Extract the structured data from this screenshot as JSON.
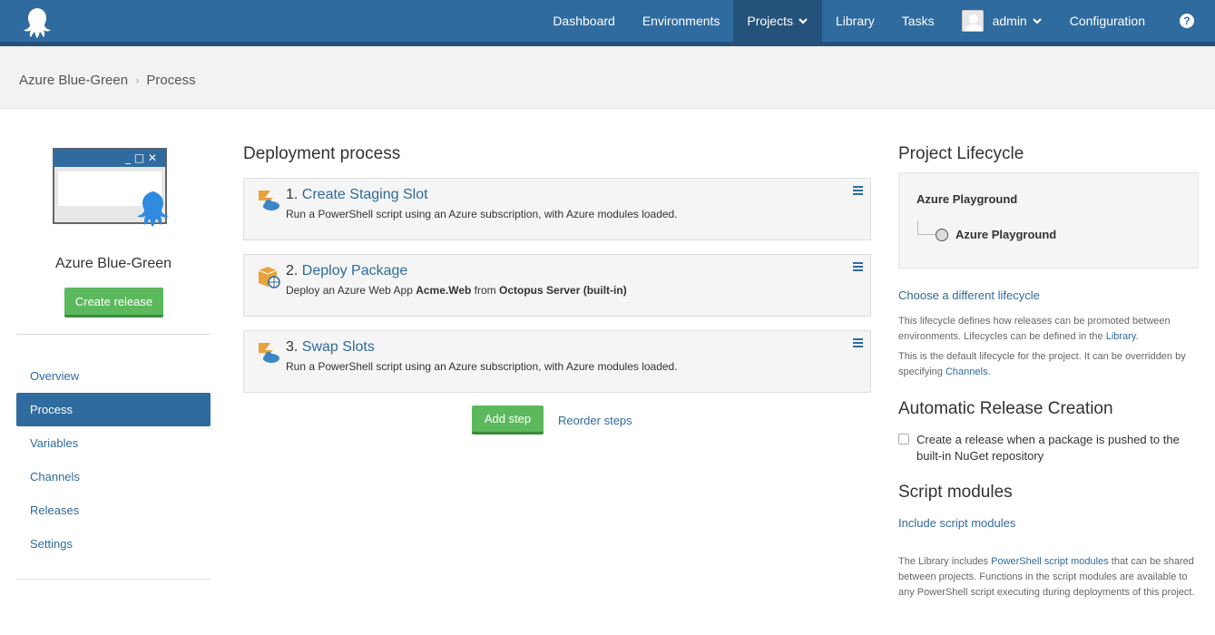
{
  "nav": {
    "items": [
      {
        "label": "Dashboard",
        "active": false
      },
      {
        "label": "Environments",
        "active": false
      },
      {
        "label": "Projects",
        "active": true,
        "dropdown": true
      },
      {
        "label": "Library",
        "active": false
      },
      {
        "label": "Tasks",
        "active": false
      }
    ],
    "user": "admin",
    "configuration": "Configuration",
    "help_icon": "question-circle-icon",
    "help_glyph": "?"
  },
  "breadcrumb": {
    "project": "Azure Blue-Green",
    "page": "Process",
    "separator": "›"
  },
  "sidebar": {
    "project_name": "Azure Blue-Green",
    "create_release": "Create release",
    "menu": [
      {
        "label": "Overview",
        "active": false
      },
      {
        "label": "Process",
        "active": true
      },
      {
        "label": "Variables",
        "active": false
      },
      {
        "label": "Channels",
        "active": false
      },
      {
        "label": "Releases",
        "active": false
      },
      {
        "label": "Settings",
        "active": false
      }
    ]
  },
  "main": {
    "heading": "Deployment process",
    "steps": [
      {
        "number": "1.",
        "name": "Create Staging Slot",
        "icon": "azure-powershell-icon",
        "desc_parts": [
          "Run a PowerShell script using an Azure subscription, with Azure modules loaded."
        ]
      },
      {
        "number": "2.",
        "name": "Deploy Package",
        "icon": "azure-web-app-icon",
        "desc_parts": [
          "Deploy an Azure Web App ",
          "Acme.Web",
          " from ",
          "Octopus Server (built-in)"
        ]
      },
      {
        "number": "3.",
        "name": "Swap Slots",
        "icon": "azure-powershell-icon",
        "desc_parts": [
          "Run a PowerShell script using an Azure subscription, with Azure modules loaded."
        ]
      }
    ],
    "add_step": "Add step",
    "reorder_steps": "Reorder steps"
  },
  "right": {
    "lifecycle_heading": "Project Lifecycle",
    "lifecycle_name": "Azure Playground",
    "lifecycle_env": "Azure Playground",
    "choose_link": "Choose a different lifecycle",
    "lifecycle_text1_a": "This lifecycle defines how releases can be promoted between environments. Lifecycles can be defined in the ",
    "lifecycle_text1_link": "Library",
    "lifecycle_text1_b": ".",
    "lifecycle_text2_a": "This is the default lifecycle for the project. It can be overridden by specifying ",
    "lifecycle_text2_link": "Channels",
    "lifecycle_text2_b": ".",
    "auto_heading": "Automatic Release Creation",
    "auto_checkbox_label": "Create a release when a package is pushed to the built-in NuGet repository",
    "auto_checked": false,
    "script_heading": "Script modules",
    "include_link": "Include script modules",
    "script_text_a": "The Library includes ",
    "script_text_link": "PowerShell script modules",
    "script_text_b": " that can be shared between projects. Functions in the script modules are available to any PowerShell script executing during deployments of this project."
  },
  "colors": {
    "nav": "#2f6b9e",
    "nav_active": "#24527a",
    "green": "#5cb85c",
    "link": "#2f6b9e"
  }
}
